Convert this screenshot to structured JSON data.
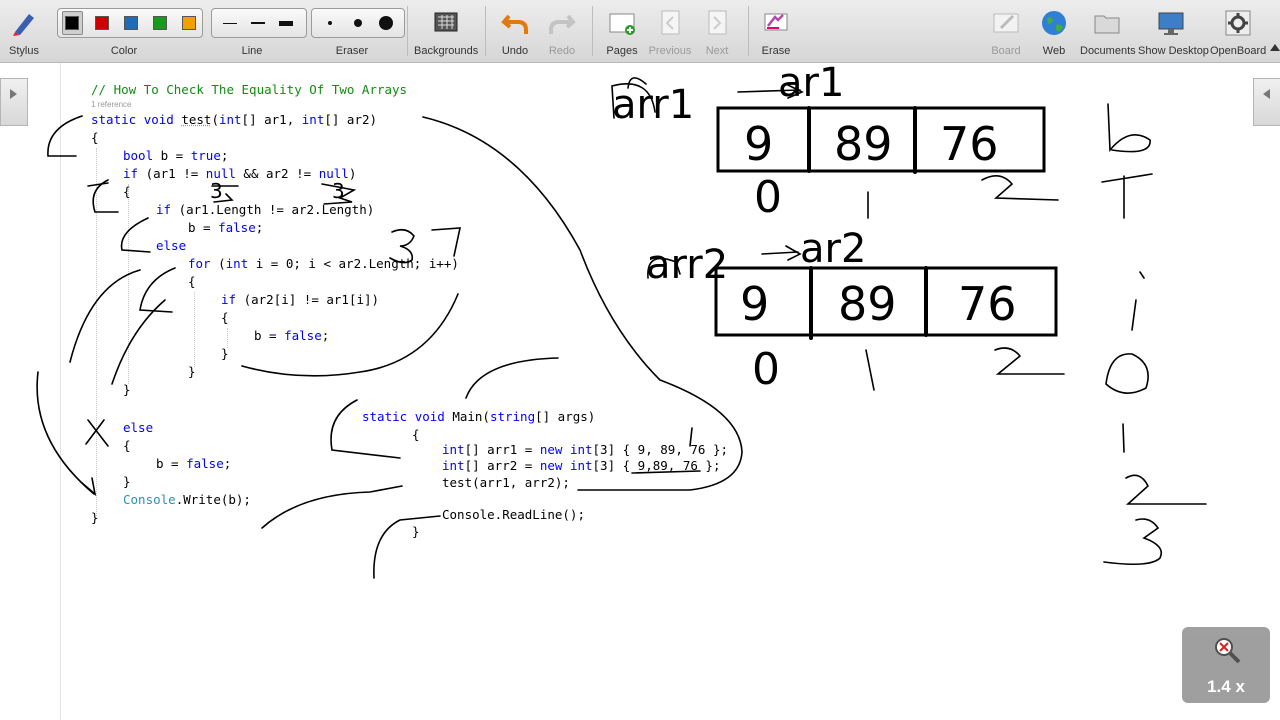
{
  "toolbar": {
    "stylus": "Stylus",
    "color": "Color",
    "line": "Line",
    "eraser": "Eraser",
    "backgrounds": "Backgrounds",
    "undo": "Undo",
    "redo": "Redo",
    "pages": "Pages",
    "previous": "Previous",
    "next": "Next",
    "erase": "Erase",
    "board": "Board",
    "web": "Web",
    "documents": "Documents",
    "show_desktop": "Show Desktop",
    "openboard": "OpenBoard",
    "colors": [
      "#000000",
      "#cc0000",
      "#1e6bb8",
      "#1a9a1a",
      "#f2a000"
    ]
  },
  "code": {
    "comment": "// How To Check The Equality Of Two Arrays",
    "ref_hint": "1 reference",
    "kw_static": "static",
    "kw_void": "void",
    "fn_test": "test",
    "kw_int": "int",
    "params_a": "[] ar1, ",
    "params_b": "[] ar2)",
    "open_paren": "(",
    "kw_bool": "bool",
    "b_eq": " b = ",
    "kw_true": "true",
    "semicolon": ";",
    "kw_if": "if",
    "cond1_a": " (ar1 != ",
    "kw_null": "null",
    "cond1_b": " && ar2 != ",
    "close_paren": ")",
    "cond2": " (ar1.Length != ar2.Length)",
    "b_assign": "b = ",
    "kw_false": "false",
    "kw_else": "else",
    "kw_for": "for",
    "for_a": " (",
    "for_b": " i = 0; i < ar2.Length; i++)",
    "cond3": " (ar2[i] != ar1[i])",
    "brace_open": "{",
    "brace_close": "}",
    "console": "Console",
    "write": ".Write(b);",
    "main_sig_b": " Main(",
    "kw_string": "string",
    "main_args": "[] args)",
    "arr1_a": "[] arr1 = ",
    "kw_new": "new",
    "arr1_b": "[3] { 9, 89, 76 };",
    "arr2_a": "[] arr2 = ",
    "arr2_b": "[3] { 9,89, 76 };",
    "test_call": "test(arr1, arr2);",
    "readline": "Console.ReadLine();"
  },
  "array1": {
    "name": "arr1",
    "alias": "ar1",
    "values": [
      "9",
      "89",
      "76"
    ],
    "indices": [
      "0",
      "1",
      "2"
    ]
  },
  "array2": {
    "name": "arr2",
    "alias": "ar2",
    "values": [
      "9",
      "89",
      "76"
    ],
    "indices": [
      "0",
      "1",
      "2"
    ]
  },
  "side_notes": [
    "b",
    "T",
    "i",
    "0",
    "1",
    "2",
    "3"
  ],
  "count_note": "3 ?",
  "zoom": {
    "level": "1.4 x"
  }
}
